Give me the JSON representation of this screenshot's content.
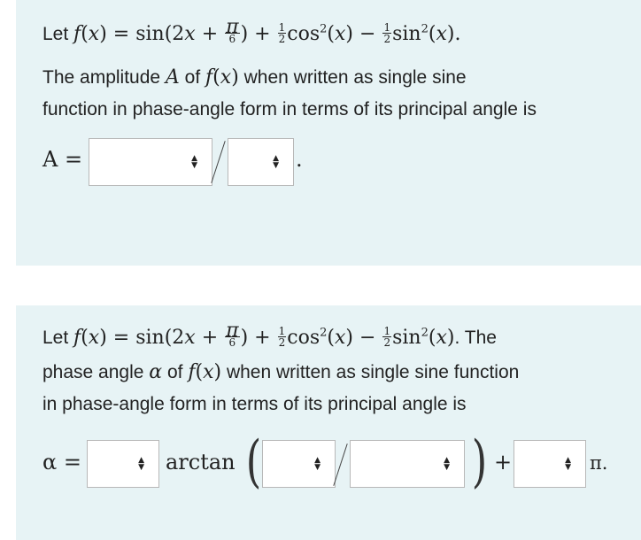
{
  "q1": {
    "intro": "Let",
    "prompt_line2": "The amplitude",
    "prompt_line2_b": "of",
    "prompt_line2_c": "when written as single sine",
    "prompt_line3": "function in phase-angle form in terms of its principal angle is",
    "answer_label": "A =",
    "end_mark": "."
  },
  "q2": {
    "intro": "Let",
    "line1_tail": ". The",
    "prompt_line2": "phase angle",
    "prompt_line2_b": "of",
    "prompt_line2_c": "when written as single sine function",
    "prompt_line3": "in phase-angle form in terms of its principal angle is",
    "answer_label": "α =",
    "arctan_label": "arctan",
    "plus": "+",
    "pi_label": "π."
  },
  "dropdown_arrow_up": "▲",
  "dropdown_arrow_down": "▼"
}
